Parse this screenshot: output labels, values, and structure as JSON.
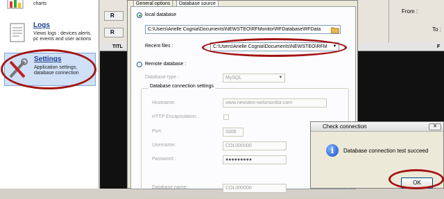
{
  "sidebar": {
    "items": [
      {
        "title": "",
        "description": "View measures in tables and charts"
      },
      {
        "title": "Logs",
        "description": "Views logs : devices alerts, pc events and user actions"
      },
      {
        "title": "Settings",
        "description": "Application settings, database connection"
      }
    ]
  },
  "background": {
    "toolbar_buttons": [
      "R",
      "R"
    ],
    "grid_header_left": "TITL",
    "grid_header_right": "F",
    "right_labels": [
      "From :",
      "To :"
    ]
  },
  "dialog": {
    "tabs": [
      "General options",
      "Database source"
    ],
    "local": {
      "label": "local database",
      "path": "C:\\Users\\Arielle Cognia\\Documents\\NEWSTEO\\RFMonitor\\RFDatabase\\RFData",
      "recent_label": "Recent files :",
      "recent_value": "C:\\Users\\Arielle Cognia\\Documents\\NEWSTEO\\RFM"
    },
    "remote": {
      "label": "Remote database :",
      "type_label": "Database type :",
      "type_value": "MySQL",
      "group_label": "Database connection settings",
      "hostname_label": "Hostname:",
      "hostname_value": "www.newsteo-webmonitor.com",
      "http_label": "HTTP Encapsulation :",
      "port_label": "Port:",
      "port_value": "3306",
      "username_label": "Username:",
      "username_value": "COL000000",
      "password_label": "Password :",
      "password_value": "●●●●●●●●●",
      "dbname_label": "Database name:",
      "dbname_value": "COL000000"
    }
  },
  "msgbox": {
    "title": "Check connection",
    "message": "Database connection test succeed",
    "ok_label": "OK",
    "close_glyph": "✕",
    "icon_glyph": "i"
  },
  "colors": {
    "highlight_ellipse": "#a41313",
    "selected_nav": "#cfe0f7"
  }
}
